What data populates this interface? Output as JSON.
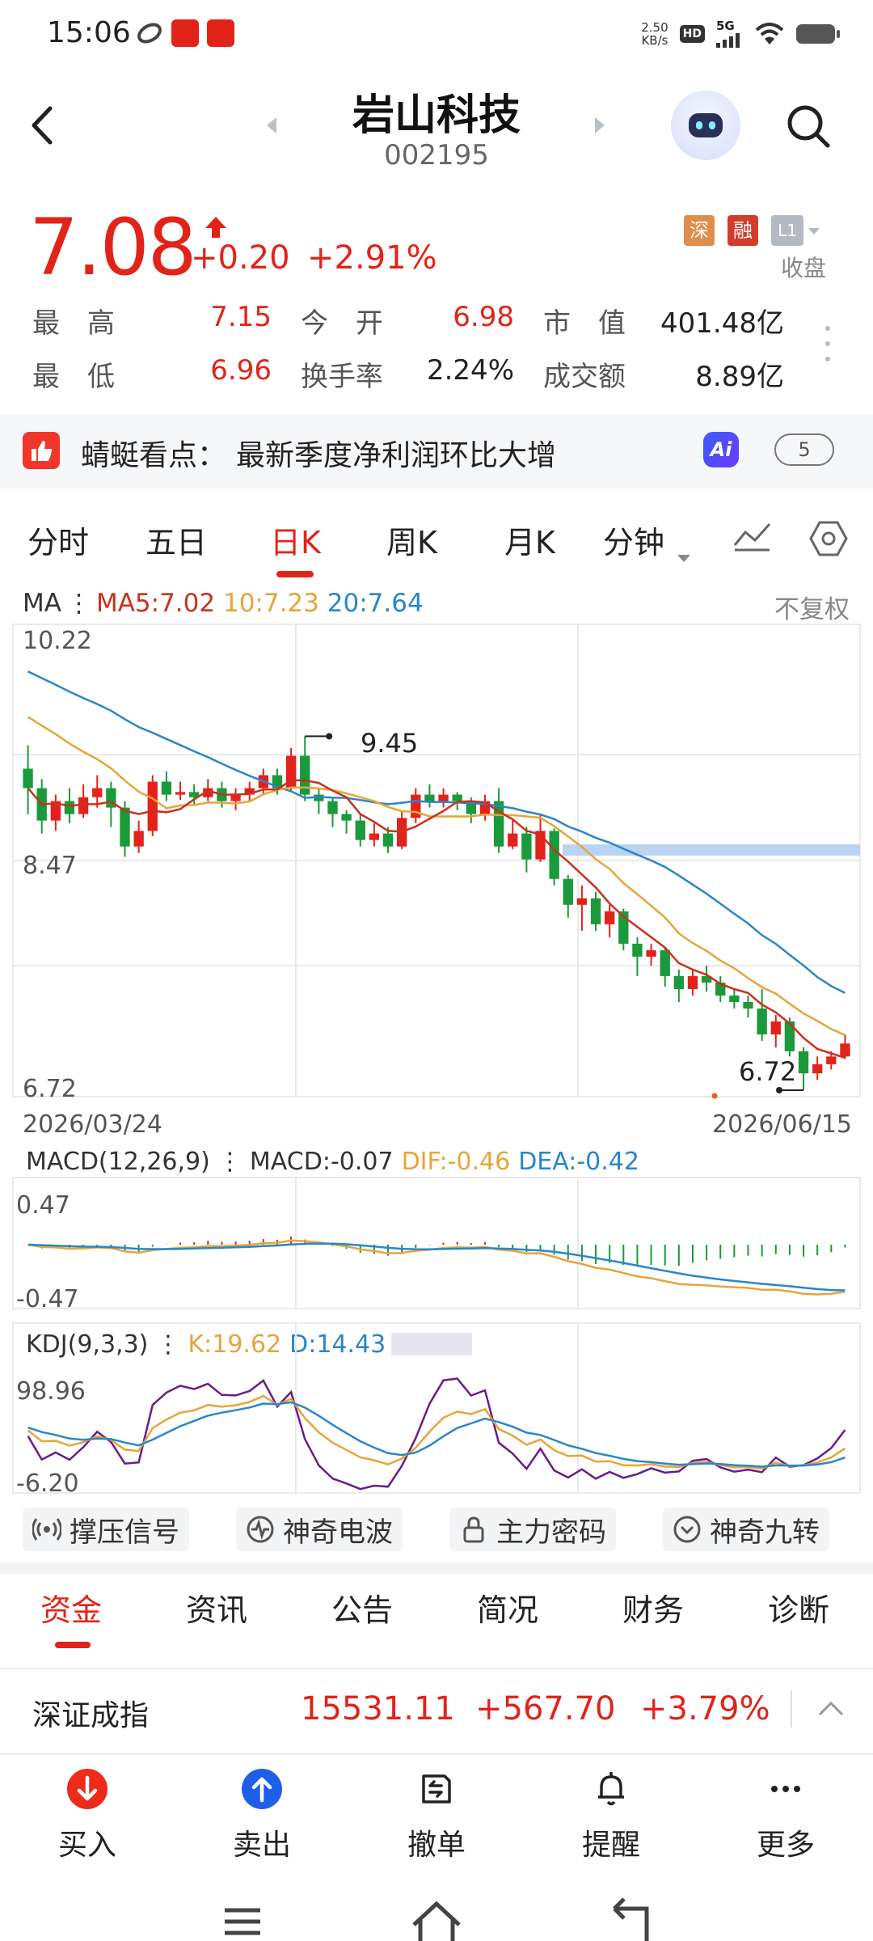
{
  "status_bar": {
    "time": "15:06",
    "net_speed_value": "2.50",
    "net_speed_unit": "KB/s",
    "hd_label": "HD",
    "signal_label": "5G"
  },
  "header": {
    "stock_name": "岩山科技",
    "stock_code": "002195"
  },
  "quote": {
    "price": "7.08",
    "change": "+0.20",
    "change_pct": "+2.91%",
    "badges": [
      "深",
      "融",
      "L1"
    ],
    "collapse_label": "收盘",
    "stats": [
      {
        "label": "最　高",
        "value": "7.15",
        "color": "red"
      },
      {
        "label": "今　开",
        "value": "6.98",
        "color": "red"
      },
      {
        "label": "市　值",
        "value": "401.48亿",
        "color": "black"
      },
      {
        "label": "最　低",
        "value": "6.96",
        "color": "red"
      },
      {
        "label": "换手率",
        "value": "2.24%",
        "color": "black"
      },
      {
        "label": "成交额",
        "value": "8.89亿",
        "color": "black"
      }
    ]
  },
  "insight": {
    "label": "蜻蜓看点：",
    "text": "最新季度净利润环比大增",
    "ai_label": "Ai",
    "count": "5"
  },
  "chart_tabs": [
    {
      "label": "分时",
      "active": false
    },
    {
      "label": "五日",
      "active": false
    },
    {
      "label": "日K",
      "active": true
    },
    {
      "label": "周K",
      "active": false
    },
    {
      "label": "月K",
      "active": false
    },
    {
      "label": "分钟",
      "active": false
    }
  ],
  "ma_legend": {
    "prefix": "MA",
    "ma5": "MA5:7.02",
    "ma10": "10:7.23",
    "ma20": "20:7.64",
    "adjust": "不复权"
  },
  "colors": {
    "up": "#e2231a",
    "down": "#1a9a3a",
    "ma5": "#c8321e",
    "ma10": "#e8a43a",
    "ma20": "#2a86c8",
    "k": "#e8a43a",
    "d": "#2a86c8",
    "j": "#6a1b8a"
  },
  "chart_data": {
    "type": "candlestick",
    "date_start": "2026/03/24",
    "date_end": "2026/06/15",
    "ylim": [
      6.72,
      10.22
    ],
    "y_ticks": [
      "10.22",
      "8.47",
      "6.72"
    ],
    "high_mark": "9.45",
    "low_mark": "6.72",
    "candles": [
      [
        9.2,
        9.05,
        9.38,
        8.85
      ],
      [
        9.05,
        8.8,
        9.12,
        8.7
      ],
      [
        8.8,
        8.95,
        9.0,
        8.72
      ],
      [
        8.95,
        8.85,
        9.05,
        8.78
      ],
      [
        8.85,
        8.98,
        9.08,
        8.82
      ],
      [
        8.98,
        9.05,
        9.15,
        8.9
      ],
      [
        9.05,
        8.9,
        9.1,
        8.75
      ],
      [
        8.9,
        8.6,
        8.95,
        8.52
      ],
      [
        8.6,
        8.72,
        8.8,
        8.55
      ],
      [
        8.72,
        9.1,
        9.15,
        8.68
      ],
      [
        9.1,
        9.0,
        9.18,
        8.95
      ],
      [
        9.0,
        9.02,
        9.1,
        8.96
      ],
      [
        9.02,
        8.98,
        9.08,
        8.92
      ],
      [
        8.98,
        9.05,
        9.12,
        8.95
      ],
      [
        9.05,
        8.95,
        9.1,
        8.9
      ],
      [
        8.95,
        9.0,
        9.05,
        8.88
      ],
      [
        9.0,
        9.05,
        9.1,
        8.95
      ],
      [
        9.05,
        9.15,
        9.2,
        9.0
      ],
      [
        9.15,
        9.05,
        9.2,
        9.0
      ],
      [
        9.05,
        9.3,
        9.36,
        9.02
      ],
      [
        9.3,
        9.0,
        9.45,
        8.95
      ],
      [
        9.0,
        8.95,
        9.05,
        8.85
      ],
      [
        8.95,
        8.85,
        8.98,
        8.75
      ],
      [
        8.85,
        8.8,
        8.88,
        8.7
      ],
      [
        8.8,
        8.65,
        8.85,
        8.6
      ],
      [
        8.65,
        8.7,
        8.78,
        8.6
      ],
      [
        8.7,
        8.6,
        8.75,
        8.55
      ],
      [
        8.6,
        8.82,
        8.88,
        8.58
      ],
      [
        8.82,
        9.0,
        9.05,
        8.78
      ],
      [
        9.0,
        8.95,
        9.08,
        8.9
      ],
      [
        8.95,
        9.0,
        9.05,
        8.9
      ],
      [
        9.0,
        8.95,
        9.02,
        8.88
      ],
      [
        8.95,
        8.85,
        8.98,
        8.78
      ],
      [
        8.85,
        8.95,
        9.0,
        8.8
      ],
      [
        8.95,
        8.6,
        9.05,
        8.55
      ],
      [
        8.6,
        8.7,
        8.8,
        8.58
      ],
      [
        8.7,
        8.5,
        8.75,
        8.4
      ],
      [
        8.5,
        8.72,
        8.85,
        8.48
      ],
      [
        8.72,
        8.35,
        8.74,
        8.3
      ],
      [
        8.35,
        8.15,
        8.38,
        8.05
      ],
      [
        8.15,
        8.2,
        8.3,
        7.95
      ],
      [
        8.2,
        8.0,
        8.25,
        7.95
      ],
      [
        8.0,
        8.1,
        8.15,
        7.9
      ],
      [
        8.1,
        7.85,
        8.12,
        7.8
      ],
      [
        7.85,
        7.75,
        7.9,
        7.6
      ],
      [
        7.75,
        7.8,
        7.85,
        7.68
      ],
      [
        7.8,
        7.6,
        7.82,
        7.52
      ],
      [
        7.6,
        7.5,
        7.65,
        7.4
      ],
      [
        7.5,
        7.6,
        7.65,
        7.45
      ],
      [
        7.6,
        7.55,
        7.68,
        7.48
      ],
      [
        7.55,
        7.45,
        7.6,
        7.4
      ],
      [
        7.45,
        7.4,
        7.5,
        7.35
      ],
      [
        7.4,
        7.35,
        7.45,
        7.28
      ],
      [
        7.35,
        7.15,
        7.5,
        7.1
      ],
      [
        7.15,
        7.25,
        7.3,
        7.05
      ],
      [
        7.25,
        7.02,
        7.28,
        6.98
      ],
      [
        7.02,
        6.85,
        7.05,
        6.72
      ],
      [
        6.85,
        6.92,
        6.98,
        6.8
      ],
      [
        6.92,
        6.98,
        7.02,
        6.88
      ],
      [
        6.98,
        7.08,
        7.15,
        6.96
      ]
    ],
    "ma20_start": [
      9.95,
      9.6
    ],
    "macd_label": "MACD(12,26,9)",
    "macd": "MACD:-0.07",
    "dif": "DIF:-0.46",
    "dea": "DEA:-0.42",
    "macd_ylim": [
      -0.47,
      0.47
    ],
    "macd_ticks": [
      "0.47",
      "-0.47"
    ],
    "kdj_label": "KDJ(9,3,3)",
    "k": "K:19.62",
    "d": "D:14.43",
    "kdj_ylim": [
      -6.2,
      98.96
    ],
    "kdj_ticks": [
      "98.96",
      "-6.20"
    ]
  },
  "indicator_buttons": [
    {
      "label": "撑压信号",
      "icon": "signal-icon"
    },
    {
      "label": "神奇电波",
      "icon": "wave-icon"
    },
    {
      "label": "主力密码",
      "icon": "lock-icon"
    },
    {
      "label": "神奇九转",
      "icon": "check-circle-icon"
    }
  ],
  "bottom_tabs": [
    {
      "label": "资金",
      "active": true
    },
    {
      "label": "资讯",
      "active": false
    },
    {
      "label": "公告",
      "active": false
    },
    {
      "label": "简况",
      "active": false
    },
    {
      "label": "财务",
      "active": false
    },
    {
      "label": "诊断",
      "active": false
    }
  ],
  "index": {
    "name": "深证成指",
    "value": "15531.11",
    "change": "+567.70",
    "pct": "+3.79%"
  },
  "actions": [
    {
      "label": "买入",
      "icon": "buy-icon"
    },
    {
      "label": "卖出",
      "icon": "sell-icon"
    },
    {
      "label": "撤单",
      "icon": "cancel-order-icon"
    },
    {
      "label": "提醒",
      "icon": "bell-icon"
    },
    {
      "label": "更多",
      "icon": "more-icon"
    }
  ]
}
